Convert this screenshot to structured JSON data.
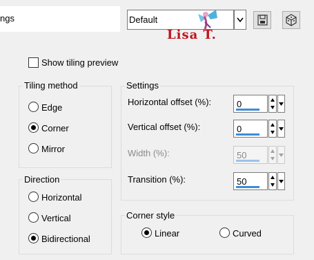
{
  "top": {
    "title_fragment": "ngs",
    "preset_value": "Default",
    "watermark": "Lisa T."
  },
  "show_tiling_preview": {
    "label": "Show tiling preview",
    "checked": false
  },
  "tiling_method": {
    "title": "Tiling method",
    "options": [
      {
        "label": "Edge",
        "selected": false
      },
      {
        "label": "Corner",
        "selected": true
      },
      {
        "label": "Mirror",
        "selected": false
      }
    ]
  },
  "direction": {
    "title": "Direction",
    "options": [
      {
        "label": "Horizontal",
        "selected": false
      },
      {
        "label": "Vertical",
        "selected": false
      },
      {
        "label": "Bidirectional",
        "selected": true
      }
    ]
  },
  "settings": {
    "title": "Settings",
    "fields": [
      {
        "label": "Horizontal offset (%):",
        "value": "0",
        "enabled": true
      },
      {
        "label": "Vertical offset (%):",
        "value": "0",
        "enabled": true
      },
      {
        "label": "Width (%):",
        "value": "50",
        "enabled": false
      },
      {
        "label": "Transition (%):",
        "value": "50",
        "enabled": true
      }
    ]
  },
  "corner_style": {
    "title": "Corner style",
    "options": [
      {
        "label": "Linear",
        "selected": true
      },
      {
        "label": "Curved",
        "selected": false
      }
    ]
  },
  "icons": [
    "save-icon",
    "randomize-dice-icon",
    "fairy-watermark-icon"
  ],
  "colors": {
    "accent_bar": "#3c8bdc",
    "watermark": "#c0141c"
  }
}
